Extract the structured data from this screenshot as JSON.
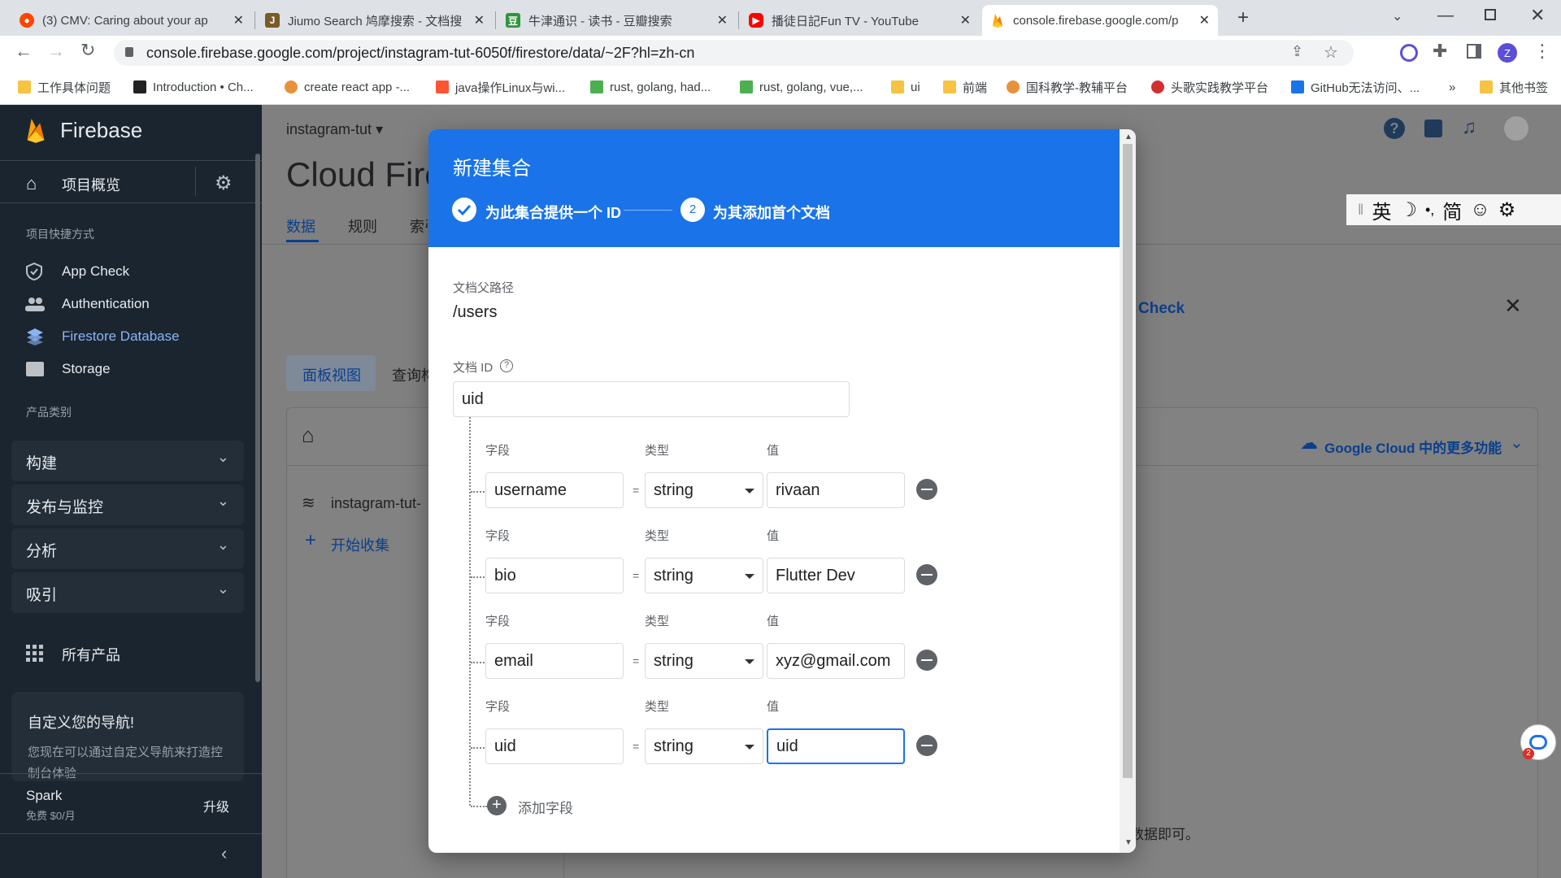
{
  "browser": {
    "tabs": [
      {
        "title": "(3) CMV: Caring about your ap",
        "icon": "reddit-icon",
        "color": "#ff4500"
      },
      {
        "title": "Jiumo Search 鸠摩搜索 - 文档搜",
        "icon": "jiumo-icon",
        "color": "#7a5a2a"
      },
      {
        "title": "牛津通识 - 读书 - 豆瓣搜索",
        "icon": "douban-icon",
        "color": "#2e963d"
      },
      {
        "title": "播徒日記Fun TV - YouTube",
        "icon": "youtube-icon",
        "color": "#ff0000"
      },
      {
        "title": "console.firebase.google.com/p",
        "icon": "firebase-icon",
        "color": "#ffa000"
      }
    ],
    "url": "console.firebase.google.com/project/instagram-tut-6050f/firestore/data/~2F?hl=zh-cn",
    "profile_initial": "Z",
    "bookmarks": [
      {
        "label": "工作具体问题",
        "icon": "folder-icon",
        "color": "#f6c342"
      },
      {
        "label": "Introduction • Ch...",
        "icon": "puzzle-icon",
        "color": "#222222"
      },
      {
        "label": "create react app -...",
        "icon": "react-icon",
        "color": "#e8913b"
      },
      {
        "label": "java操作Linux与wi...",
        "icon": "csdn-icon",
        "color": "#fc5531"
      },
      {
        "label": "rust, golang, had...",
        "icon": "trend-icon",
        "color": "#4caf50"
      },
      {
        "label": "rust, golang, vue,...",
        "icon": "trend-icon",
        "color": "#4caf50"
      },
      {
        "label": "ui",
        "icon": "folder-icon",
        "color": "#f6c342"
      },
      {
        "label": "前端",
        "icon": "folder-icon",
        "color": "#f6c342"
      },
      {
        "label": "国科教学-教辅平台",
        "icon": "school-icon",
        "color": "#e8913b"
      },
      {
        "label": "头歌实践教学平台",
        "icon": "toge-icon",
        "color": "#d32f2f"
      },
      {
        "label": "GitHub无法访问、...",
        "icon": "github-icon",
        "color": "#1a73e8"
      }
    ],
    "bookmarks_more": "»",
    "other_bookmarks": "其他书签"
  },
  "sidebar": {
    "brand": "Firebase",
    "overview": "项目概览",
    "shortcuts_heading": "项目快捷方式",
    "shortcuts": [
      {
        "label": "App Check",
        "icon": "shield-icon",
        "active": false
      },
      {
        "label": "Authentication",
        "icon": "people-icon",
        "active": false
      },
      {
        "label": "Firestore Database",
        "icon": "firestore-icon",
        "active": true
      },
      {
        "label": "Storage",
        "icon": "image-icon",
        "active": false
      }
    ],
    "categories_heading": "产品类别",
    "groups": [
      "构建",
      "发布与监控",
      "分析",
      "吸引"
    ],
    "all_products": "所有产品",
    "custom_nav_title": "自定义您的导航!",
    "custom_nav_text": "您现在可以通过自定义导航来打造控制台体验",
    "plan_name": "Spark",
    "plan_price": "免费 $0/月",
    "upgrade": "升级",
    "active_color": "#8ab4f8"
  },
  "main": {
    "project": "instagram-tut",
    "title": "Cloud Firestore",
    "tabs": [
      "数据",
      "规则",
      "索引"
    ],
    "view_tab": "面板视图",
    "query_tab": "查询构建器",
    "root_collection": "instagram-tut-6050f",
    "start_collection": "开始收集",
    "app_check_banner": "Check",
    "gcloud_more": "Google Cloud 中的更多功能",
    "bottom_text": "您的数据库已设置完毕，添加数据即可。"
  },
  "ime": {
    "lang": "英",
    "moon": "☽",
    "punct": "•,",
    "simp": "简",
    "smile": "☺",
    "gear": "⚙"
  },
  "dialog": {
    "title": "新建集合",
    "step1": "为此集合提供一个 ID",
    "step2_num": "2",
    "step2": "为其添加首个文档",
    "parent_path_label": "文档父路径",
    "parent_path": "/users",
    "doc_id_label": "文档 ID",
    "doc_id": "uid",
    "field_label": "字段",
    "type_label": "类型",
    "value_label": "值",
    "eq": "=",
    "fields": [
      {
        "name": "username",
        "type": "string",
        "value": "rivaan"
      },
      {
        "name": "bio",
        "type": "string",
        "value": "Flutter Dev"
      },
      {
        "name": "email",
        "type": "string",
        "value": "xyz@gmail.com"
      },
      {
        "name": "uid",
        "type": "string",
        "value": "uid"
      }
    ],
    "add_field": "添加字段",
    "accent": "#1a73e8"
  }
}
